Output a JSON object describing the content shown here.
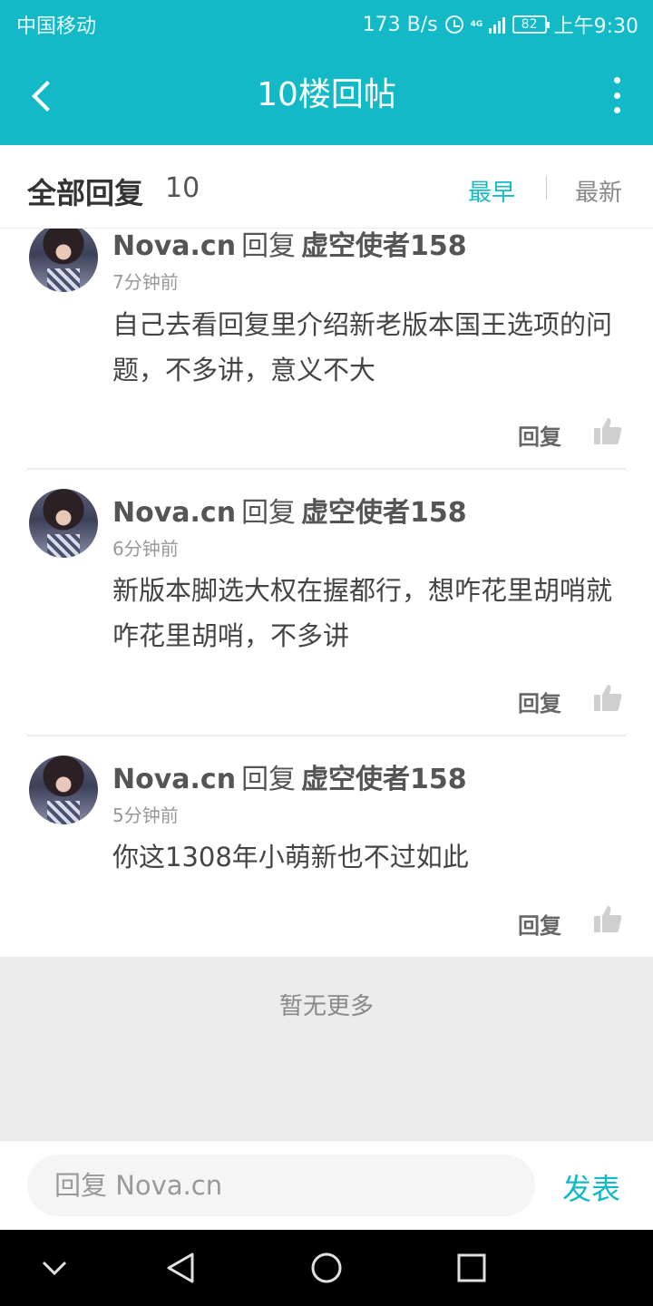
{
  "status_bar": {
    "carrier": "中国移动",
    "speed": "173 B/s",
    "network": "4G",
    "battery": "82",
    "time": "上午9:30"
  },
  "title_bar": {
    "title": "10楼回帖",
    "back_icon": "chevron-left-icon",
    "more_icon": "more-vertical-icon"
  },
  "sort_header": {
    "heading": "全部回复",
    "count": "10",
    "earliest": "最早",
    "latest": "最新",
    "active_color": "#14b9c8"
  },
  "replies": [
    {
      "user": "Nova.cn",
      "verb": "回复",
      "target": "虚空使者158",
      "time": "7分钟前",
      "content": "自己去看回复里介绍新老版本国王选项的问题，不多讲，意义不大",
      "reply_label": "回复"
    },
    {
      "user": "Nova.cn",
      "verb": "回复",
      "target": "虚空使者158",
      "time": "6分钟前",
      "content": "新版本脚选大权在握都行，想咋花里胡哨就咋花里胡哨，不多讲",
      "reply_label": "回复"
    },
    {
      "user": "Nova.cn",
      "verb": "回复",
      "target": "虚空使者158",
      "time": "5分钟前",
      "content": "你这1308年小萌新也不过如此",
      "reply_label": "回复"
    }
  ],
  "footer": {
    "no_more": "暂无更多"
  },
  "input_bar": {
    "placeholder": "回复 Nova.cn",
    "send_label": "发表"
  },
  "nav_bar": {
    "icons": [
      "chevron-down-icon",
      "back-triangle-icon",
      "home-circle-icon",
      "recents-square-icon"
    ]
  },
  "colors": {
    "brand": "#14b9c8",
    "background_gray": "#ececec"
  }
}
